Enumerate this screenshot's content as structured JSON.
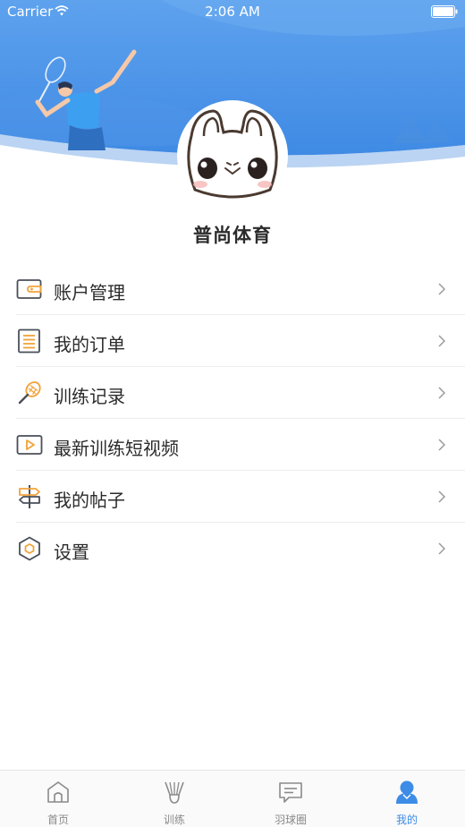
{
  "status_bar": {
    "carrier": "Carrier",
    "time": "2:06 AM"
  },
  "profile": {
    "username": "普尚体育"
  },
  "menu": {
    "items": [
      {
        "label": "账户管理",
        "icon": "wallet-icon"
      },
      {
        "label": "我的订单",
        "icon": "order-list-icon"
      },
      {
        "label": "训练记录",
        "icon": "racket-icon"
      },
      {
        "label": "最新训练短视频",
        "icon": "video-play-icon"
      },
      {
        "label": "我的帖子",
        "icon": "signpost-icon"
      },
      {
        "label": "设置",
        "icon": "settings-hexagon-icon"
      }
    ]
  },
  "tab_bar": {
    "tabs": [
      {
        "label": "首页",
        "icon": "home-icon"
      },
      {
        "label": "训练",
        "icon": "shuttlecock-icon"
      },
      {
        "label": "羽球圈",
        "icon": "chat-bubble-icon"
      },
      {
        "label": "我的",
        "icon": "user-profile-icon"
      }
    ],
    "active_index": 3
  },
  "colors": {
    "header_blue": "#5aa0ee",
    "icon_orange": "#f2a23a",
    "active_tab": "#3d8ce6"
  }
}
